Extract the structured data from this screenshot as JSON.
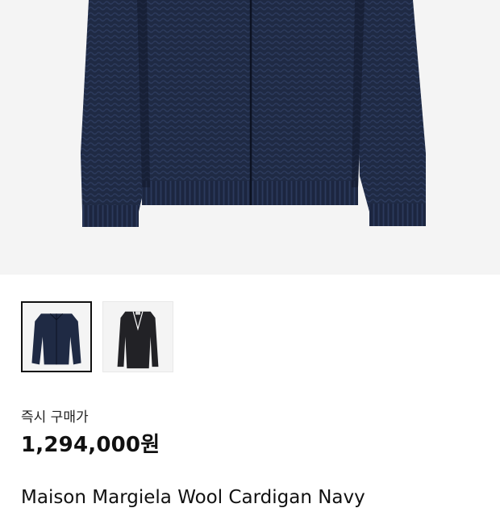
{
  "product": {
    "main_image": "navy-knit-cardigan-photo",
    "thumbnails": [
      {
        "name": "navy-cardigan-thumbnail",
        "color": "#1f2a44",
        "selected": true
      },
      {
        "name": "black-cardigan-thumbnail",
        "color": "#222226",
        "selected": false
      }
    ],
    "price_label": "즉시 구매가",
    "price": "1,294,000원",
    "name": "Maison Margiela Wool Cardigan Navy"
  },
  "colors": {
    "image_background": "#f4f4f4",
    "navy_knit": "#1f2a44",
    "black_knit": "#222226"
  }
}
